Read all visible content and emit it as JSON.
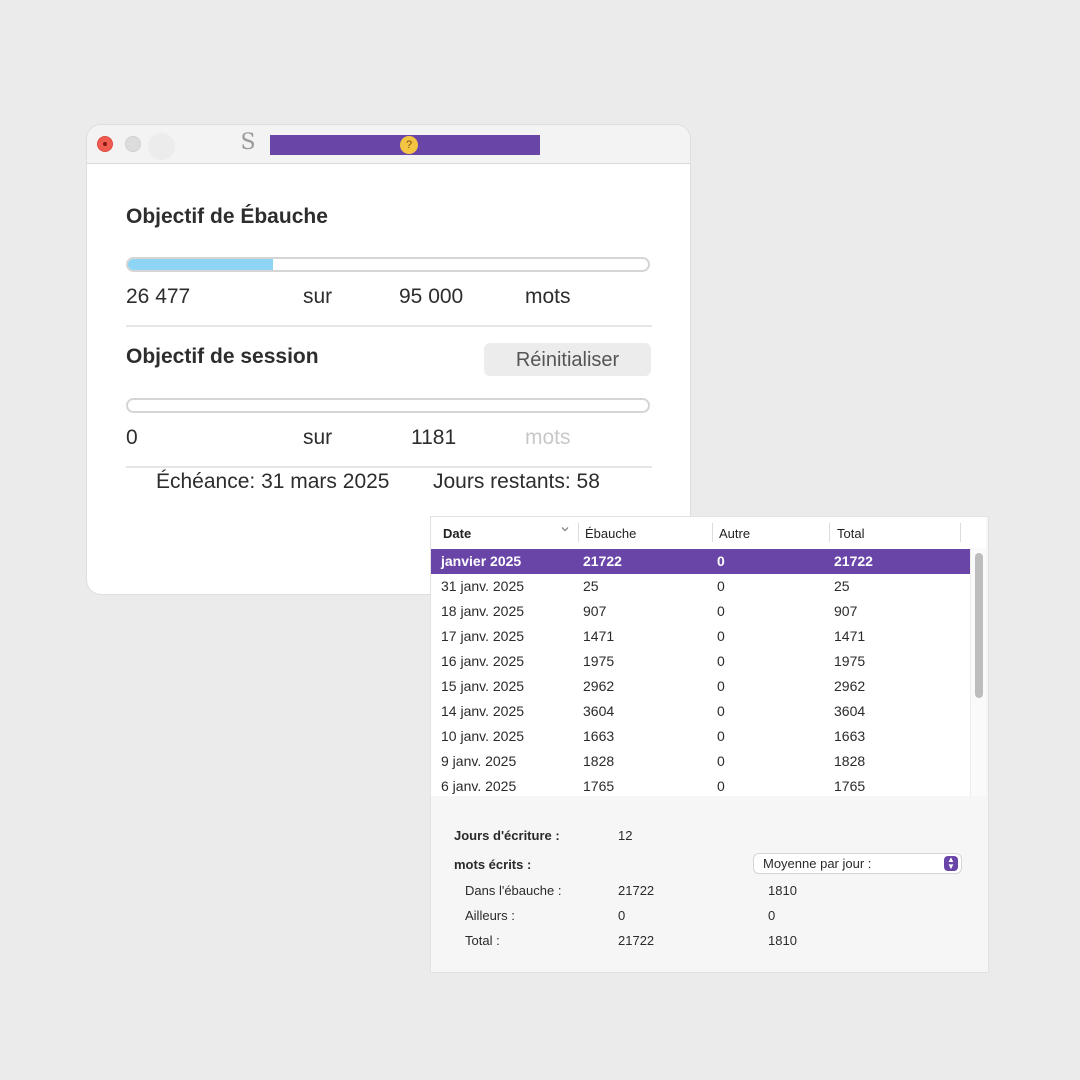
{
  "window": {
    "app_icon": "S"
  },
  "draft_goal": {
    "title": "Objectif de Ébauche",
    "current": "26 477",
    "of_label": "sur",
    "target": "95 000",
    "unit": "mots",
    "progress": 0.279
  },
  "session_goal": {
    "title": "Objectif de session",
    "reset_label": "Réinitialiser",
    "current": "0",
    "of_label": "sur",
    "target": "1181",
    "unit": "mots",
    "progress": 0
  },
  "deadline": {
    "deadline_text": "Échéance: 31 mars 2025",
    "days_left_text": "Jours restants: 58"
  },
  "table": {
    "headers": [
      "Date",
      "Ébauche",
      "Autre",
      "Total"
    ],
    "rows": [
      {
        "date": "janvier 2025",
        "ebauche": "21722",
        "autre": "0",
        "total": "21722",
        "selected": true
      },
      {
        "date": "31 janv. 2025",
        "ebauche": "25",
        "autre": "0",
        "total": "25"
      },
      {
        "date": "18 janv. 2025",
        "ebauche": "907",
        "autre": "0",
        "total": "907"
      },
      {
        "date": "17 janv. 2025",
        "ebauche": "1471",
        "autre": "0",
        "total": "1471"
      },
      {
        "date": "16 janv. 2025",
        "ebauche": "1975",
        "autre": "0",
        "total": "1975"
      },
      {
        "date": "15 janv. 2025",
        "ebauche": "2962",
        "autre": "0",
        "total": "2962"
      },
      {
        "date": "14 janv. 2025",
        "ebauche": "3604",
        "autre": "0",
        "total": "3604"
      },
      {
        "date": "10 janv. 2025",
        "ebauche": "1663",
        "autre": "0",
        "total": "1663"
      },
      {
        "date": "9 janv. 2025",
        "ebauche": "1828",
        "autre": "0",
        "total": "1828"
      },
      {
        "date": "6 janv. 2025",
        "ebauche": "1765",
        "autre": "0",
        "total": "1765"
      }
    ]
  },
  "stats": {
    "writing_days_label": "Jours d'écriture :",
    "writing_days_value": "12",
    "words_written_label": "mots écrits :",
    "average_select": "Moyenne par jour :",
    "in_draft_label": "Dans l'ébauche :",
    "in_draft_value": "21722",
    "in_draft_avg": "1810",
    "elsewhere_label": "Ailleurs :",
    "elsewhere_value": "0",
    "elsewhere_avg": "0",
    "total_label": "Total :",
    "total_value": "21722",
    "total_avg": "1810"
  },
  "colors": {
    "accent": "#6a45a8",
    "progress_fill": "#8ed5f5",
    "close_button": "#f15b50"
  },
  "icons": [
    "close-icon",
    "minimize-icon",
    "zoom-icon",
    "scrivener-app-icon",
    "emoji-icon",
    "chevron-down-icon",
    "stepper-icon"
  ]
}
